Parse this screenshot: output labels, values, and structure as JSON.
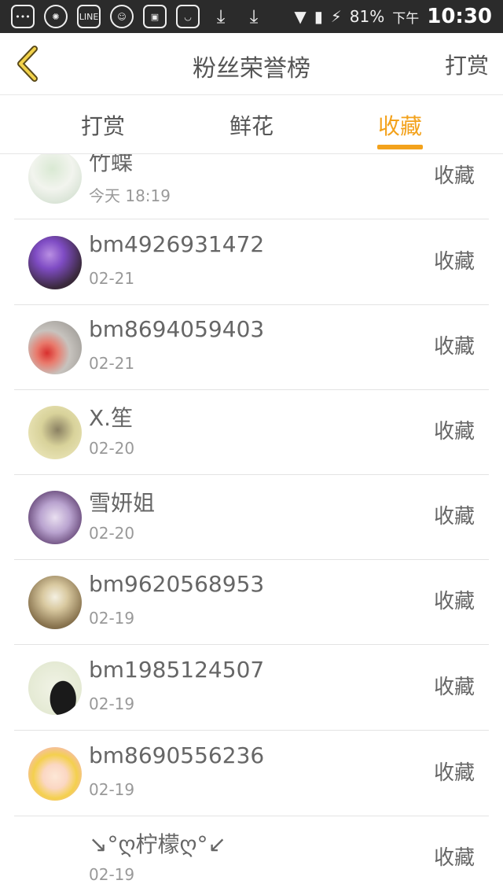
{
  "status_bar": {
    "icons": [
      "messages-icon",
      "aperture-icon",
      "line-icon",
      "chat-icon",
      "image-icon",
      "shopping-icon",
      "download-icon",
      "download-icon",
      "wifi-icon",
      "sim-icon",
      "battery-charging-icon"
    ],
    "battery": "81%",
    "ampm": "下午",
    "time": "10:30"
  },
  "header": {
    "title": "粉丝荣誉榜",
    "action_label": "打赏"
  },
  "tabs": [
    {
      "label": "打赏",
      "active": false
    },
    {
      "label": "鲜花",
      "active": false
    },
    {
      "label": "收藏",
      "active": true
    }
  ],
  "colors": {
    "accent": "#f3a21c"
  },
  "fans": [
    {
      "name": "竹蝶",
      "date": "今天 18:19",
      "action": "收藏",
      "avatar": "avatar-sketch-girl"
    },
    {
      "name": "bm4926931472",
      "date": "02-21",
      "action": "收藏",
      "avatar": "avatar-purple-balloons"
    },
    {
      "name": "bm8694059403",
      "date": "02-21",
      "action": "收藏",
      "avatar": "avatar-strawberry-hand"
    },
    {
      "name": "X.笙",
      "date": "02-20",
      "action": "收藏",
      "avatar": "avatar-yellow-photo"
    },
    {
      "name": "雪妍姐",
      "date": "02-20",
      "action": "收藏",
      "avatar": "avatar-anime-purple"
    },
    {
      "name": "bm9620568953",
      "date": "02-19",
      "action": "收藏",
      "avatar": "avatar-dandelion"
    },
    {
      "name": "bm1985124507",
      "date": "02-19",
      "action": "收藏",
      "avatar": "avatar-person-black"
    },
    {
      "name": "bm8690556236",
      "date": "02-19",
      "action": "收藏",
      "avatar": "avatar-cartoon-girl"
    },
    {
      "name": "↘°ღ柠檬ღ°↙",
      "date": "02-19",
      "action": "收藏",
      "avatar": "avatar-empty"
    }
  ]
}
